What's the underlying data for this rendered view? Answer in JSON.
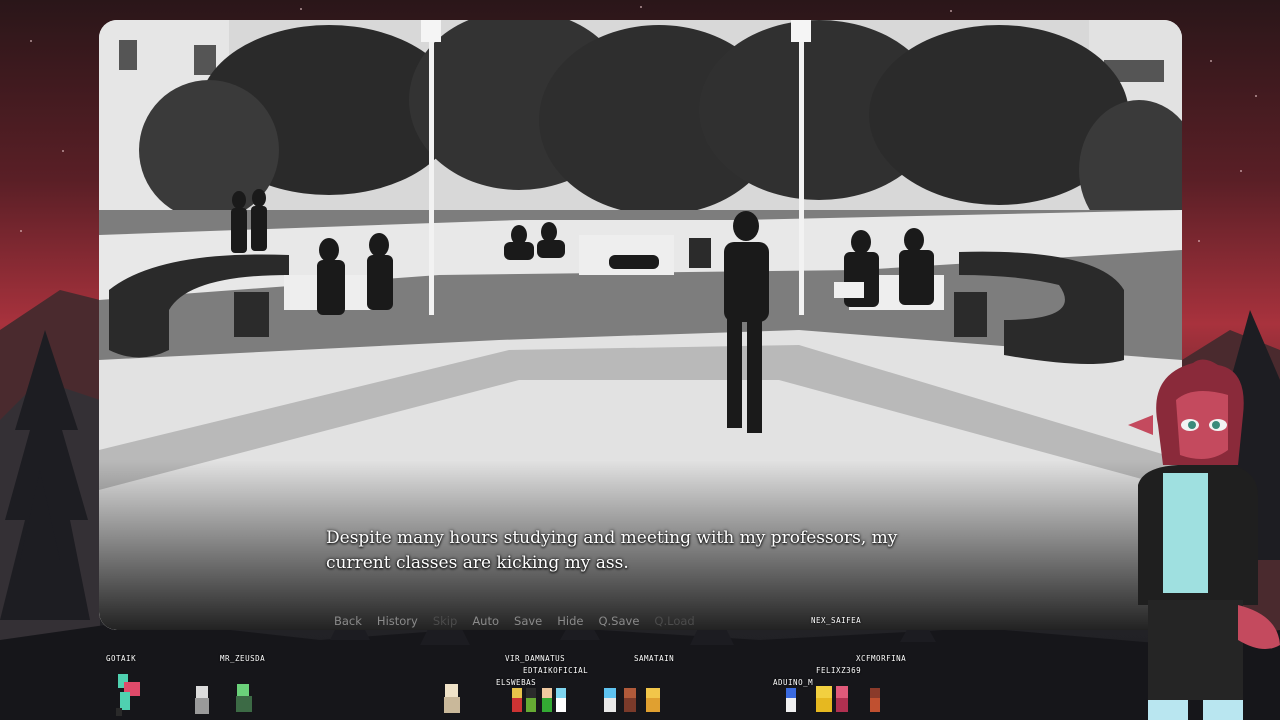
{
  "dialogue": {
    "text": "Despite many hours studying and meeting with my professors, my current classes are kicking my ass."
  },
  "quick_menu": [
    {
      "label": "Back",
      "enabled": true
    },
    {
      "label": "History",
      "enabled": true
    },
    {
      "label": "Skip",
      "enabled": false
    },
    {
      "label": "Auto",
      "enabled": true
    },
    {
      "label": "Save",
      "enabled": true
    },
    {
      "label": "Hide",
      "enabled": true
    },
    {
      "label": "Q.Save",
      "enabled": true
    },
    {
      "label": "Q.Load",
      "enabled": false
    }
  ],
  "stream_overlay": {
    "names": [
      "NEX_SAIFEA",
      "GOTAIK",
      "MR_ZEUSDA",
      "VIR_DAMNATUS",
      "EDTAIKOFICIAL",
      "SAMATAIN",
      "ELSWEBAS",
      "ADUINO_M",
      "FELIXZ369",
      "XCFMORFINA"
    ]
  },
  "colors": {
    "sky_accent": "#a8323d",
    "dialogue_text": "#ffffff",
    "menu_text": "#8a8a8a",
    "menu_disabled": "#4c4c4c"
  }
}
